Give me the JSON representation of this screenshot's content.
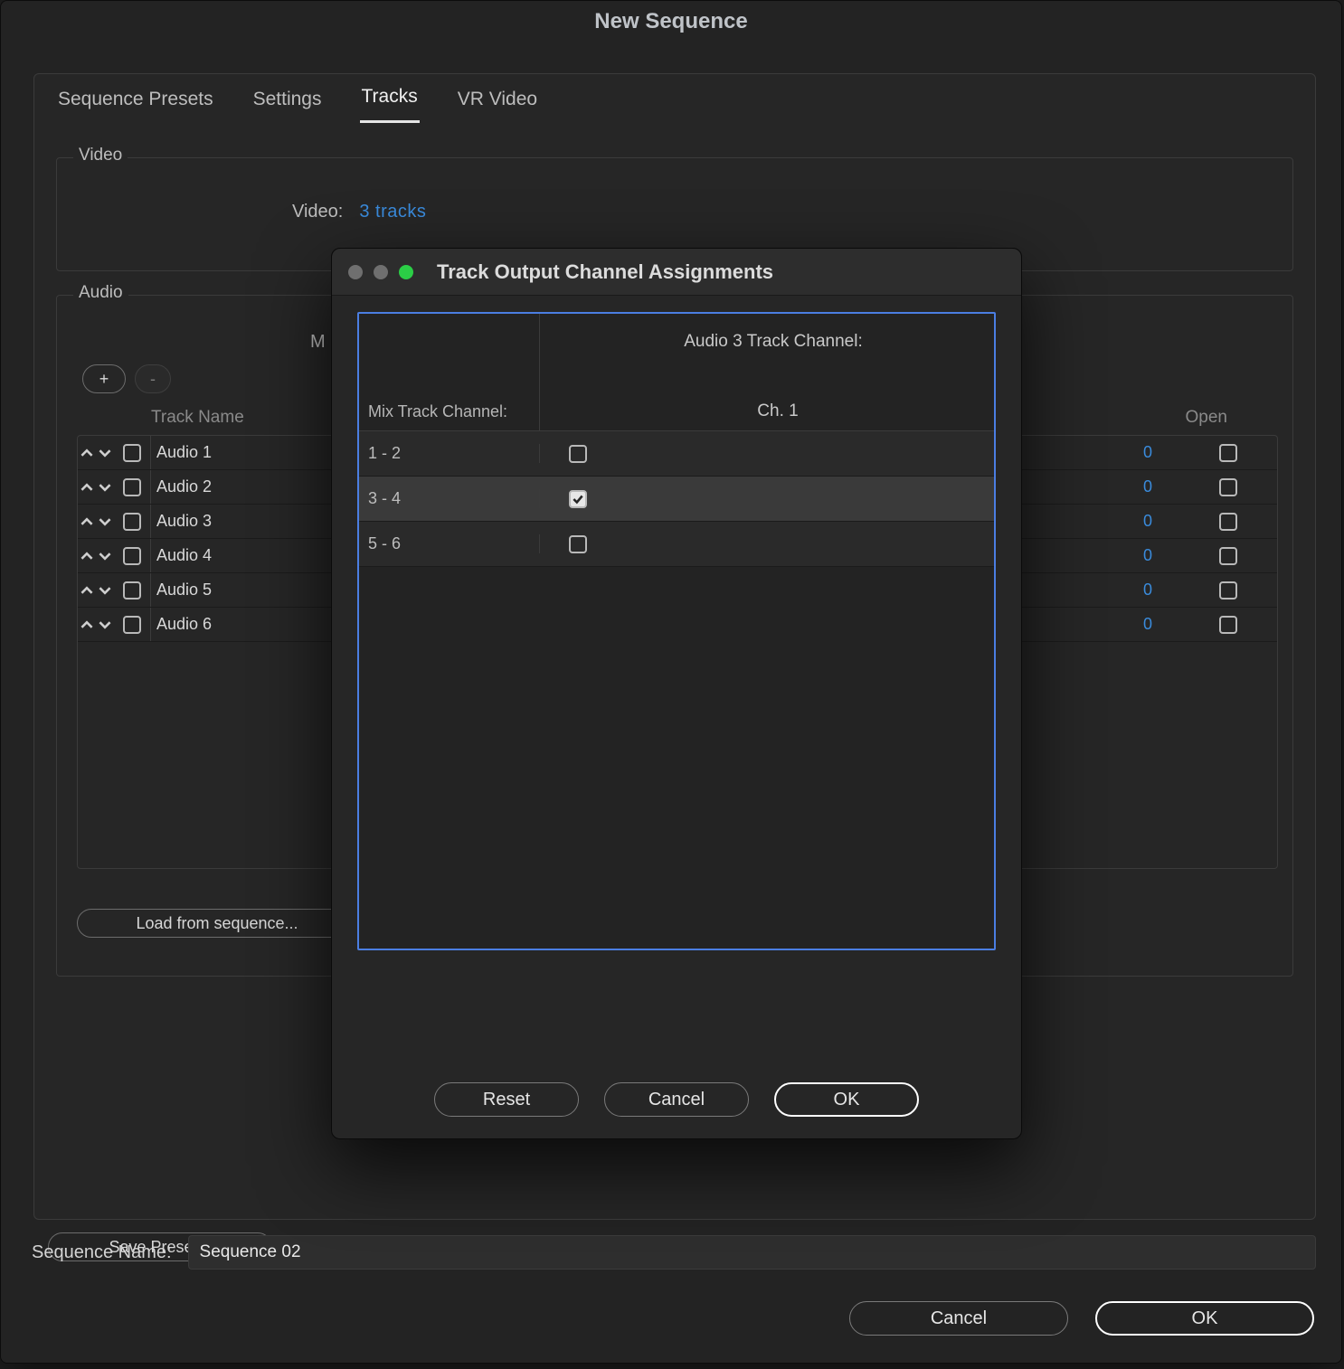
{
  "dialog": {
    "title": "New Sequence",
    "tabs": [
      "Sequence Presets",
      "Settings",
      "Tracks",
      "VR Video"
    ],
    "active_tab_index": 2,
    "video": {
      "legend": "Video",
      "label": "Video:",
      "value": "3 tracks"
    },
    "audio": {
      "legend": "Audio",
      "partial_label": "M",
      "add_label": "+",
      "remove_label": "-",
      "header_left": "Track Name",
      "header_right": "Open",
      "tracks": [
        {
          "name": "Audio 1",
          "pan": "0",
          "open": false
        },
        {
          "name": "Audio 2",
          "pan": "0",
          "open": false
        },
        {
          "name": "Audio 3",
          "pan": "0",
          "open": false
        },
        {
          "name": "Audio 4",
          "pan": "0",
          "open": false
        },
        {
          "name": "Audio 5",
          "pan": "0",
          "open": false
        },
        {
          "name": "Audio 6",
          "pan": "0",
          "open": false
        }
      ],
      "load_button": "Load from sequence..."
    },
    "save_preset": "Save Preset...",
    "sequence_name_label": "Sequence Name:",
    "sequence_name_value": "Sequence 02",
    "cancel": "Cancel",
    "ok": "OK"
  },
  "modal": {
    "title": "Track Output Channel Assignments",
    "mix_header": "Mix Track Channel:",
    "track_header": "Audio 3 Track Channel:",
    "channel_label": "Ch. 1",
    "rows": [
      {
        "mix": "1 - 2",
        "checked": false
      },
      {
        "mix": "3 - 4",
        "checked": true
      },
      {
        "mix": "5 - 6",
        "checked": false
      }
    ],
    "reset": "Reset",
    "cancel": "Cancel",
    "ok": "OK"
  }
}
